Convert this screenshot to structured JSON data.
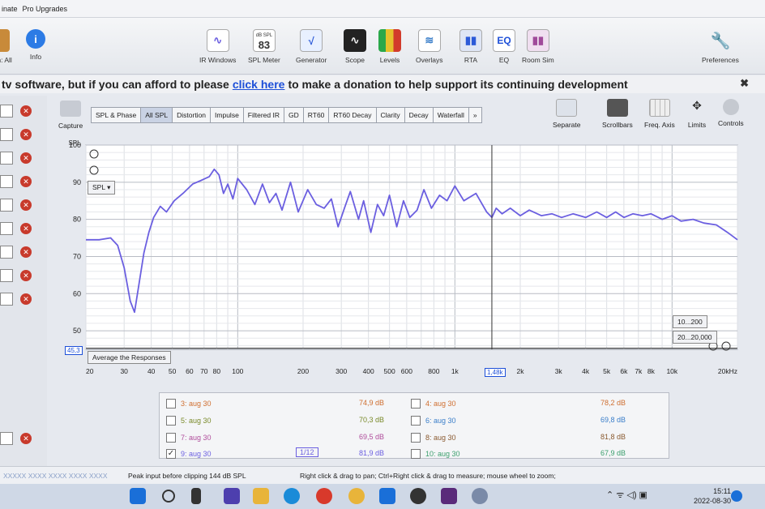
{
  "menu": {
    "items": [
      "inate",
      "Pro Upgrades"
    ]
  },
  "toolbar": {
    "left_labels": [
      "In: All",
      "Info"
    ],
    "buttons": [
      {
        "label": "IR Windows",
        "icon": "ir-windows-icon"
      },
      {
        "label": "SPL Meter",
        "icon": "spl-meter-icon",
        "top": "dB SPL",
        "value": "83"
      },
      {
        "label": "Generator",
        "icon": "generator-icon"
      },
      {
        "label": "Scope",
        "icon": "scope-icon"
      },
      {
        "label": "Levels",
        "icon": "levels-icon"
      },
      {
        "label": "Overlays",
        "icon": "overlays-icon"
      },
      {
        "label": "RTA",
        "icon": "rta-icon"
      },
      {
        "label": "EQ",
        "icon": "eq-icon"
      },
      {
        "label": "Room Sim",
        "icon": "room-sim-icon"
      }
    ],
    "preferences": "Preferences"
  },
  "banner": {
    "prefix": "tv software, but if you can afford to please",
    "link": "click here",
    "suffix": "to make a donation to help support its continuing development",
    "close": "✖"
  },
  "capture": "Capture",
  "tabs": [
    "SPL & Phase",
    "All SPL",
    "Distortion",
    "Impulse",
    "Filtered IR",
    "GD",
    "RT60",
    "RT60 Decay",
    "Clarity",
    "Decay",
    "Waterfall",
    "»"
  ],
  "active_tab": "All SPL",
  "right_tools": [
    "Separate",
    "Scrollbars",
    "Freq. Axis",
    "Limits",
    "Controls"
  ],
  "graph": {
    "y_unit": "SPL",
    "spl_select": "SPL",
    "average_button": "Average the Responses",
    "y_cursor": "45,3",
    "x_cursor": "1,48k",
    "range_buttons": [
      "10...200",
      "20...20,000"
    ],
    "x_tick_labels": [
      "20",
      "30",
      "40",
      "50",
      "60",
      "70",
      "80",
      "100",
      "200",
      "300",
      "400",
      "500",
      "600",
      "800",
      "1k",
      "2k",
      "3k",
      "4k",
      "5k",
      "6k",
      "7k",
      "8k",
      "10k",
      "20kHz"
    ],
    "y_tick_labels": [
      "100",
      "90",
      "80",
      "70",
      "60",
      "50"
    ]
  },
  "chart_data": {
    "type": "line",
    "ylabel": "SPL",
    "xscale": "log",
    "xlim": [
      20,
      20000
    ],
    "ylim": [
      45,
      100
    ],
    "grid": true,
    "series": [
      {
        "color": "#6b5fe0",
        "x": [
          20,
          23,
          26,
          28,
          30,
          32,
          33.5,
          35,
          37,
          39,
          41,
          44,
          47,
          51,
          56,
          62,
          68,
          74,
          78,
          82,
          86,
          90,
          95,
          100,
          110,
          120,
          130,
          140,
          150,
          160,
          175,
          190,
          210,
          230,
          250,
          270,
          290,
          310,
          330,
          360,
          380,
          410,
          440,
          470,
          500,
          540,
          580,
          620,
          670,
          720,
          780,
          850,
          920,
          1000,
          1100,
          1250,
          1400,
          1480,
          1550,
          1650,
          1800,
          2000,
          2200,
          2500,
          2800,
          3100,
          3500,
          4000,
          4500,
          5000,
          5500,
          6000,
          6600,
          7300,
          8000,
          9000,
          10000,
          11000,
          12500,
          14000,
          16000,
          18000,
          20000
        ],
        "y": [
          74.5,
          74.5,
          75.0,
          73.0,
          67.0,
          58.0,
          55.0,
          62.0,
          71.0,
          76.5,
          80.5,
          83.5,
          82.0,
          85.0,
          87.0,
          89.5,
          90.5,
          91.5,
          93.5,
          92.0,
          87.0,
          89.5,
          85.5,
          91.0,
          88.0,
          84.0,
          89.5,
          84.5,
          87.0,
          82.5,
          90.0,
          82.0,
          88.0,
          84.0,
          83.0,
          85.5,
          78.0,
          83.0,
          87.5,
          80.0,
          85.0,
          76.5,
          84.0,
          81.0,
          86.5,
          78.0,
          85.0,
          80.5,
          82.5,
          88.0,
          83.0,
          86.5,
          85.0,
          89.0,
          85.0,
          87.0,
          82.0,
          80.5,
          83.0,
          81.5,
          83.0,
          81.0,
          82.5,
          81.0,
          81.5,
          80.5,
          81.5,
          80.5,
          82.0,
          80.5,
          82.0,
          80.5,
          81.5,
          81.0,
          81.5,
          80.0,
          81.0,
          79.5,
          80.0,
          79.0,
          78.5,
          76.5,
          74.5
        ]
      }
    ]
  },
  "measurements": [
    {
      "name": "3: aug 30",
      "value": "74,9 dB",
      "checked": false,
      "color": "#cf6f30"
    },
    {
      "name": "4: aug 30",
      "value": "78,2 dB",
      "checked": false,
      "color": "#cf6f30"
    },
    {
      "name": "5: aug 30",
      "value": "70,3 dB",
      "checked": false,
      "color": "#7a8a2a"
    },
    {
      "name": "6: aug 30",
      "value": "69,8 dB",
      "checked": false,
      "color": "#3a7ec9"
    },
    {
      "name": "7: aug 30",
      "value": "69,5 dB",
      "checked": false,
      "color": "#b04e9c"
    },
    {
      "name": "8: aug 30",
      "value": "81,8 dB",
      "checked": false,
      "color": "#8a5a30"
    },
    {
      "name": "9: aug 30",
      "value": "81,9 dB",
      "checked": true,
      "color": "#6b5fe0",
      "smoothing": "1/12"
    },
    {
      "name": "10: aug 30",
      "value": "67,9 dB",
      "checked": false,
      "color": "#3a9e6c"
    }
  ],
  "status": {
    "levels": "XXXXX XXXX XXXX XXXX XXXX",
    "peak": "Peak input before clipping 144 dB SPL",
    "hint": "Right click & drag to pan; Ctrl+Right click & drag to measure; mouse wheel to zoom;"
  },
  "tray": {
    "time": "15:11",
    "date": "2022-08-30"
  }
}
